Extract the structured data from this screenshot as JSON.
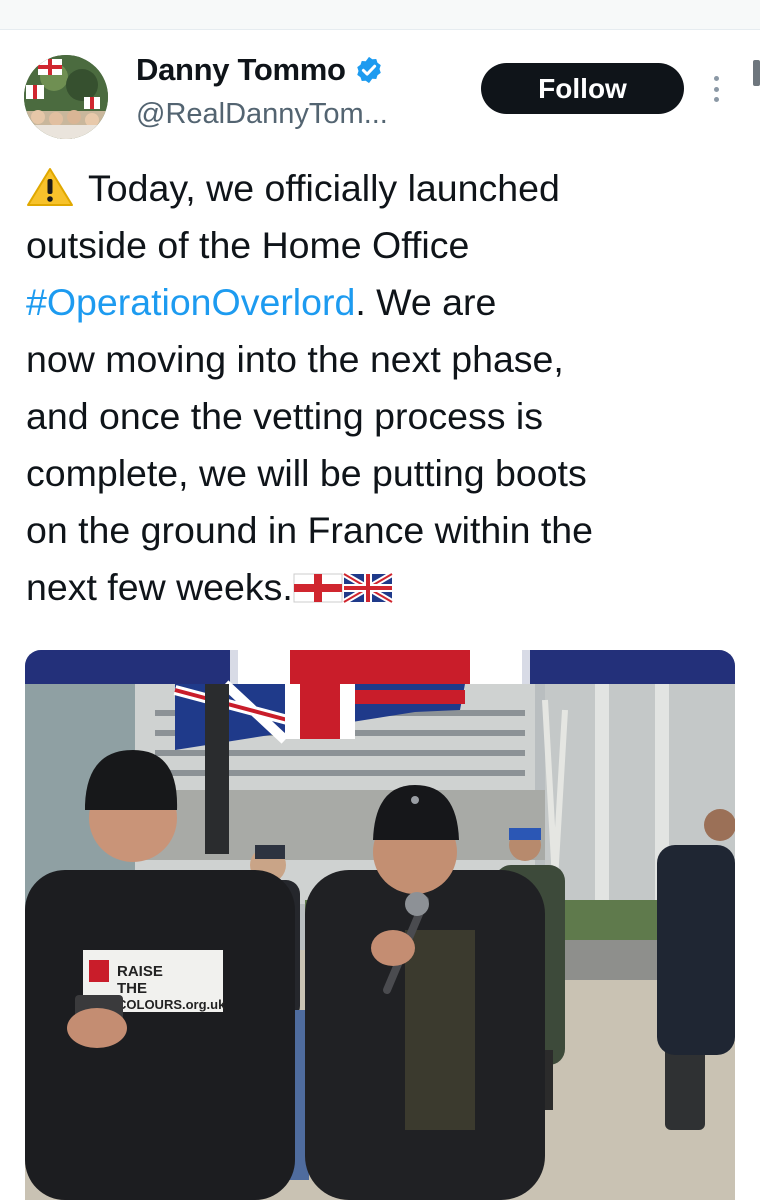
{
  "tweet": {
    "author": {
      "display_name": "Danny Tommo",
      "handle": "@RealDannyTom...",
      "verified": true
    },
    "follow_label": "Follow",
    "text_lines": [
      {
        "parts": [
          {
            "t": "Today, we officially launched"
          }
        ]
      },
      {
        "parts": [
          {
            "t": "outside of the Home Office"
          }
        ]
      },
      {
        "parts": [
          {
            "t": "#OperationOverlord",
            "hashtag": true
          },
          {
            "t": ". We are"
          }
        ]
      },
      {
        "parts": [
          {
            "t": "now moving into the next phase,"
          }
        ]
      },
      {
        "parts": [
          {
            "t": "and once the vetting process is"
          }
        ]
      },
      {
        "parts": [
          {
            "t": "complete, we will be putting boots"
          }
        ]
      },
      {
        "parts": [
          {
            "t": "on the ground in France within the"
          }
        ]
      },
      {
        "parts": [
          {
            "t": "next few weeks."
          }
        ]
      }
    ],
    "emojis": [
      "warning-icon",
      "england-flag-icon",
      "union-jack-icon"
    ],
    "media": {
      "sign_text": [
        "RAISE",
        "THE",
        "COLOURS.org.uk"
      ]
    }
  },
  "colors": {
    "text": "#0f1419",
    "secondary": "#536471",
    "hashtag": "#1d9bf0",
    "verified": "#1d9bf0",
    "follow_bg": "#0f1419"
  }
}
